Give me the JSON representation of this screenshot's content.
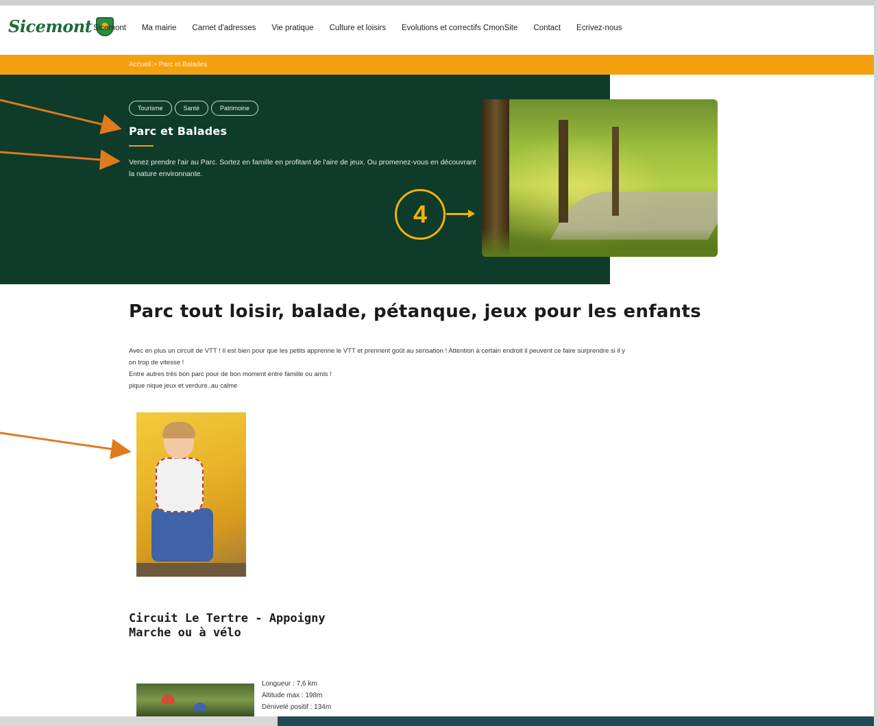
{
  "header": {
    "logo_text": "Sicemont",
    "nav": [
      "Sicemont",
      "Ma mairie",
      "Carnet d'adresses",
      "Vie pratique",
      "Culture et loisirs",
      "Evolutions et correctifs CmonSite",
      "Contact",
      "Ecrivez-nous"
    ]
  },
  "breadcrumb": "Accueil > Parc et Balades",
  "hero": {
    "tags": [
      "Tourisme",
      "Santé",
      "Patrimoine"
    ],
    "title": "Parc et Balades",
    "description": "Venez prendre l'air au Parc. Sortez en famille en profitant de l'aire de jeux. Ou promenez-vous en découvrant la nature environnante.",
    "accent_color": "#f5a00f",
    "background_color": "#0f3b2a"
  },
  "annotation": {
    "badge": "4",
    "badge_color": "#f3b400",
    "arrow_color": "#e07a1f"
  },
  "main": {
    "title": "Parc tout loisir, balade, pétanque, jeux pour les enfants",
    "paragraph_lines": [
      "Avec en plus un circuit de VTT ! Il est bien pour que les petits apprenne le VTT et prennent goût au sensation ! Attention à certain endroit il peuvent ce faire surprendre si il y",
      "on trop de vitesse !",
      "Entre autres très bon parc pour de bon moment entre famille ou amis !",
      "pique nique jeux et verdure..au calme"
    ],
    "circuit_title_line1": "Circuit Le Tertre - Appoigny",
    "circuit_title_line2": "Marche ou à vélo",
    "stats": [
      "Longueur : 7,6 km",
      "Altitude max : 198m",
      "Dénivelé positif : 134m"
    ]
  }
}
